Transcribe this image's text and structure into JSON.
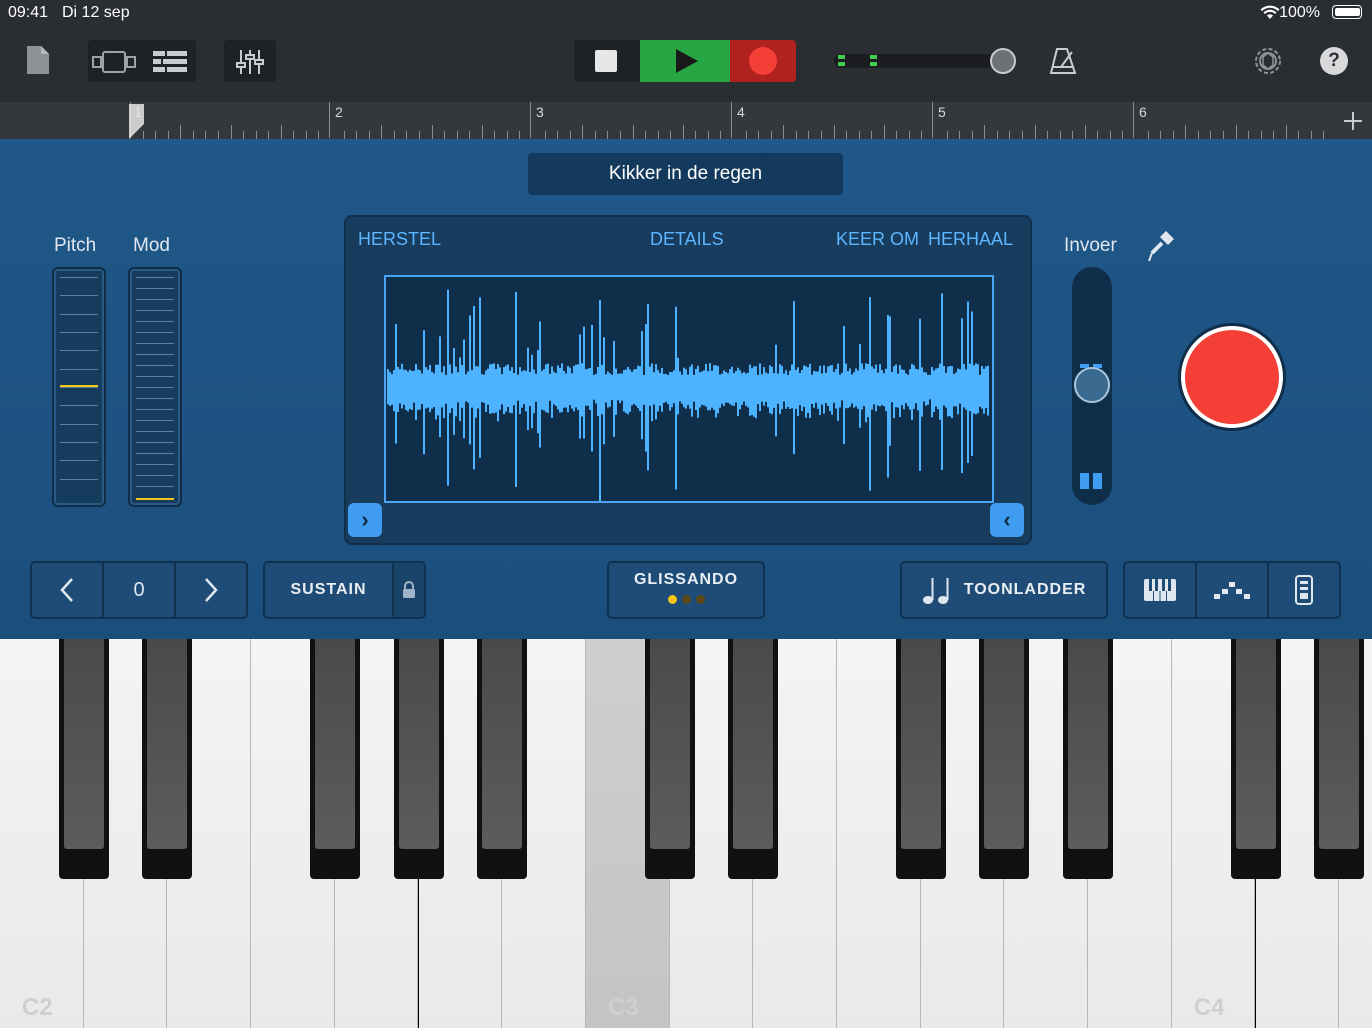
{
  "status_bar": {
    "time": "09:41",
    "date": "Di 12 sep",
    "battery": "100%"
  },
  "ruler": {
    "bars": [
      "1",
      "2",
      "3",
      "4",
      "5",
      "6"
    ]
  },
  "panel": {
    "title": "Kikker in de regen",
    "pitch_label": "Pitch",
    "mod_label": "Mod",
    "sampler_links": {
      "reset": "HERSTEL",
      "details": "DETAILS",
      "reverse": "KEER OM",
      "repeat": "HERHAAL"
    },
    "input_label": "Invoer"
  },
  "controls": {
    "octave_value": "0",
    "sustain_label": "SUSTAIN",
    "glissando_label": "GLISSANDO",
    "scale_label": "TOONLADDER"
  },
  "keyboard": {
    "labels": [
      "C2",
      "C3",
      "C4"
    ],
    "pressed": "C3"
  },
  "colors": {
    "accent_blue": "#3f9cf0",
    "record_red": "#f43f37",
    "play_green": "#27a744",
    "panel_blue": "#1f5889"
  },
  "icons": [
    "document-icon",
    "track-view-icon",
    "list-view-icon",
    "mixer-icon",
    "stop-icon",
    "play-icon",
    "record-icon",
    "master-volume-icon",
    "metronome-icon",
    "settings-icon",
    "help-icon",
    "add-section-icon",
    "input-jack-icon",
    "lock-icon",
    "note-icon",
    "keyboard-icon",
    "arpeggio-icon",
    "sound-device-icon",
    "chevron-left-icon",
    "chevron-right-icon"
  ]
}
